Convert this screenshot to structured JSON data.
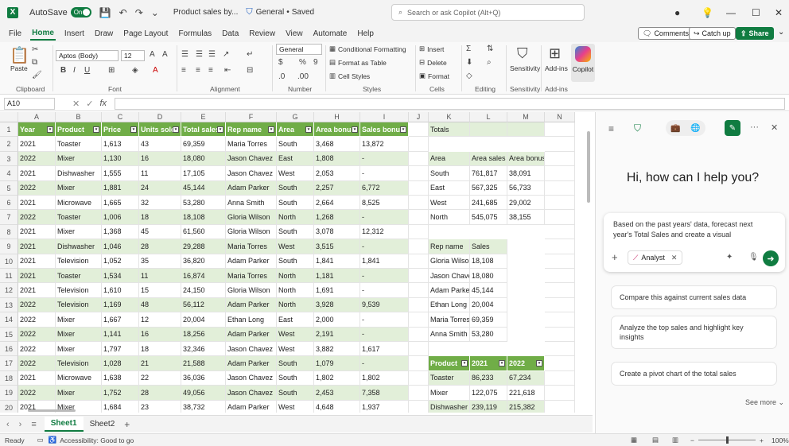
{
  "titlebar": {
    "app_letter": "X",
    "autosave_label": "AutoSave",
    "autosave_state": "On",
    "doc_title": "Product sales by...",
    "sensitivity": "General",
    "save_status": "Saved",
    "search_placeholder": "Search or ask Copilot (Alt+Q)"
  },
  "menu": {
    "tabs": [
      "File",
      "Home",
      "Insert",
      "Draw",
      "Page Layout",
      "Formulas",
      "Data",
      "Review",
      "View",
      "Automate",
      "Help"
    ],
    "active": "Home",
    "comments": "Comments",
    "catch_up": "Catch up",
    "share": "Share"
  },
  "ribbon": {
    "font_name": "Aptos (Body)",
    "font_size": "12",
    "number_format": "General",
    "cond_format": "Conditional Formatting",
    "format_table": "Format as Table",
    "cell_styles": "Cell Styles",
    "insert": "Insert",
    "delete": "Delete",
    "format": "Format",
    "sensitivity": "Sensitivity",
    "addins": "Add-ins",
    "copilot": "Copilot",
    "paste": "Paste",
    "groups": [
      "Clipboard",
      "Font",
      "Alignment",
      "Number",
      "Styles",
      "Cells",
      "Editing",
      "Sensitivity",
      "Add-ins"
    ]
  },
  "formula_bar": {
    "name_box": "A10",
    "fx": "fx",
    "value": ""
  },
  "grid": {
    "col_letters": [
      "A",
      "B",
      "C",
      "D",
      "E",
      "F",
      "G",
      "H",
      "I",
      "J",
      "K",
      "L",
      "M",
      "N"
    ],
    "row_numbers": [
      "1",
      "2",
      "3",
      "4",
      "5",
      "6",
      "7",
      "8",
      "9",
      "10",
      "11",
      "12",
      "13",
      "14",
      "15",
      "16",
      "17",
      "18",
      "19",
      "20"
    ],
    "headers": [
      "Year",
      "Product",
      "Price",
      "Units sold",
      "Total sales",
      "Rep name",
      "Area",
      "Area bonus",
      "Sales bonus"
    ],
    "rows": [
      [
        "2021",
        "Toaster",
        "1,613",
        "43",
        "69,359",
        "Maria Torres",
        "South",
        "3,468",
        "13,872"
      ],
      [
        "2022",
        "Mixer",
        "1,130",
        "16",
        "18,080",
        "Jason Chavez",
        "East",
        "1,808",
        "-"
      ],
      [
        "2021",
        "Dishwasher",
        "1,555",
        "11",
        "17,105",
        "Jason Chavez",
        "West",
        "2,053",
        "-"
      ],
      [
        "2022",
        "Mixer",
        "1,881",
        "24",
        "45,144",
        "Adam Parker",
        "South",
        "2,257",
        "6,772"
      ],
      [
        "2021",
        "Microwave",
        "1,665",
        "32",
        "53,280",
        "Anna Smith",
        "South",
        "2,664",
        "8,525"
      ],
      [
        "2022",
        "Toaster",
        "1,006",
        "18",
        "18,108",
        "Gloria Wilson",
        "North",
        "1,268",
        "-"
      ],
      [
        "2021",
        "Mixer",
        "1,368",
        "45",
        "61,560",
        "Gloria Wilson",
        "South",
        "3,078",
        "12,312"
      ],
      [
        "2021",
        "Dishwasher",
        "1,046",
        "28",
        "29,288",
        "Maria Torres",
        "West",
        "3,515",
        "-"
      ],
      [
        "2021",
        "Television",
        "1,052",
        "35",
        "36,820",
        "Adam Parker",
        "South",
        "1,841",
        "1,841"
      ],
      [
        "2021",
        "Toaster",
        "1,534",
        "11",
        "16,874",
        "Maria Torres",
        "North",
        "1,181",
        "-"
      ],
      [
        "2021",
        "Television",
        "1,610",
        "15",
        "24,150",
        "Gloria Wilson",
        "North",
        "1,691",
        "-"
      ],
      [
        "2022",
        "Television",
        "1,169",
        "48",
        "56,112",
        "Adam Parker",
        "North",
        "3,928",
        "9,539"
      ],
      [
        "2022",
        "Mixer",
        "1,667",
        "12",
        "20,004",
        "Ethan Long",
        "East",
        "2,000",
        "-"
      ],
      [
        "2022",
        "Mixer",
        "1,141",
        "16",
        "18,256",
        "Adam Parker",
        "West",
        "2,191",
        "-"
      ],
      [
        "2022",
        "Mixer",
        "1,797",
        "18",
        "32,346",
        "Jason Chavez",
        "West",
        "3,882",
        "1,617"
      ],
      [
        "2022",
        "Television",
        "1,028",
        "21",
        "21,588",
        "Adam Parker",
        "South",
        "1,079",
        "-"
      ],
      [
        "2021",
        "Microwave",
        "1,638",
        "22",
        "36,036",
        "Jason Chavez",
        "South",
        "1,802",
        "1,802"
      ],
      [
        "2022",
        "Mixer",
        "1,752",
        "28",
        "49,056",
        "Jason Chavez",
        "South",
        "2,453",
        "7,358"
      ],
      [
        "2021",
        "Mixer",
        "1,684",
        "23",
        "38,732",
        "Adam Parker",
        "West",
        "4,648",
        "1,937"
      ]
    ],
    "totals_label": "Totals",
    "area_headers": [
      "Area",
      "Area sales",
      "Area bonus"
    ],
    "area_rows": [
      [
        "South",
        "761,817",
        "38,091"
      ],
      [
        "East",
        "567,325",
        "56,733"
      ],
      [
        "West",
        "241,685",
        "29,002"
      ],
      [
        "North",
        "545,075",
        "38,155"
      ]
    ],
    "rep_headers": [
      "Rep name",
      "Sales"
    ],
    "rep_rows": [
      [
        "Gloria Wilson",
        "18,108"
      ],
      [
        "Jason Chavez",
        "18,080"
      ],
      [
        "Adam Parker",
        "45,144"
      ],
      [
        "Ethan Long",
        "20,004"
      ],
      [
        "Maria Torres",
        "69,359"
      ],
      [
        "Anna Smith",
        "53,280"
      ]
    ],
    "prod_headers": [
      "Product",
      "2021",
      "2022"
    ],
    "prod_rows": [
      [
        "Toaster",
        "86,233",
        "67,234"
      ],
      [
        "Mixer",
        "122,075",
        "221,618"
      ],
      [
        "Dishwasher",
        "239,119",
        "215,382"
      ]
    ]
  },
  "sheets": {
    "tabs": [
      "Sheet1",
      "Sheet2"
    ],
    "active": "Sheet1"
  },
  "status": {
    "ready": "Ready",
    "accessibility": "Accessibility: Good to go",
    "zoom": "100%"
  },
  "copilot": {
    "greeting": "Hi, how can I help you?",
    "prompt": "Based on the past years' data, forecast next year's Total Sales and create a visual",
    "agent": "Analyst",
    "suggestions": [
      "Compare this against current sales data",
      "Analyze the top sales and highlight key insights",
      "Create a pivot chart of the total sales"
    ],
    "see_more": "See more"
  }
}
